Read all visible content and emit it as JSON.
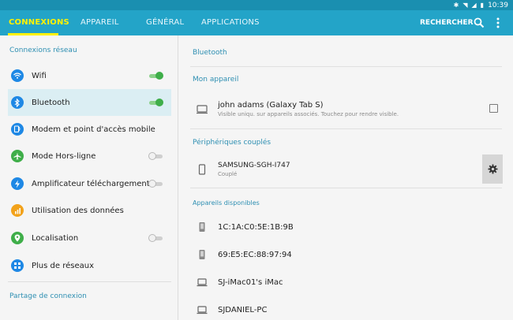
{
  "status": {
    "time": "10:39"
  },
  "tabs": [
    {
      "label": "CONNEXIONS",
      "active": true
    },
    {
      "label": "APPAREIL",
      "active": false
    },
    {
      "label": "GÉNÉRAL",
      "active": false
    },
    {
      "label": "APPLICATIONS",
      "active": false
    }
  ],
  "toolbar": {
    "search_label": "RECHERCHER"
  },
  "sidebar": {
    "section1": "Connexions réseau",
    "section2": "Partage de connexion",
    "items": [
      {
        "label": "Wifi",
        "toggle": "on"
      },
      {
        "label": "Bluetooth",
        "toggle": "on",
        "selected": true
      },
      {
        "label": "Modem et point d'accès mobile"
      },
      {
        "label": "Mode Hors-ligne",
        "toggle": "off"
      },
      {
        "label": "Amplificateur téléchargement",
        "toggle": "off"
      },
      {
        "label": "Utilisation des données"
      },
      {
        "label": "Localisation",
        "toggle": "off"
      },
      {
        "label": "Plus de réseaux"
      }
    ]
  },
  "bluetooth": {
    "title": "Bluetooth",
    "my_device_header": "Mon appareil",
    "my_device_name": "john adams (Galaxy Tab S)",
    "my_device_sub": "Visible uniqu. sur appareils associés. Touchez pour rendre visible.",
    "paired_header": "Périphériques couplés",
    "paired_devices": [
      {
        "name": "SAMSUNG-SGH-I747",
        "status": "Couplé"
      }
    ],
    "available_header": "Appareils disponibles",
    "available_devices": [
      {
        "name": "1C:1A:C0:5E:1B:9B",
        "icon": "phone-icon"
      },
      {
        "name": "69:E5:EC:88:97:94",
        "icon": "phone-icon"
      },
      {
        "name": "SJ-iMac01's iMac",
        "icon": "laptop-icon"
      },
      {
        "name": "SJDANIEL-PC",
        "icon": "laptop-icon"
      }
    ]
  },
  "colors": {
    "accent": "#23a4c8",
    "active_tab": "#fff200",
    "section_title": "#2e8fb2",
    "toggle_on": "#3fae49"
  }
}
